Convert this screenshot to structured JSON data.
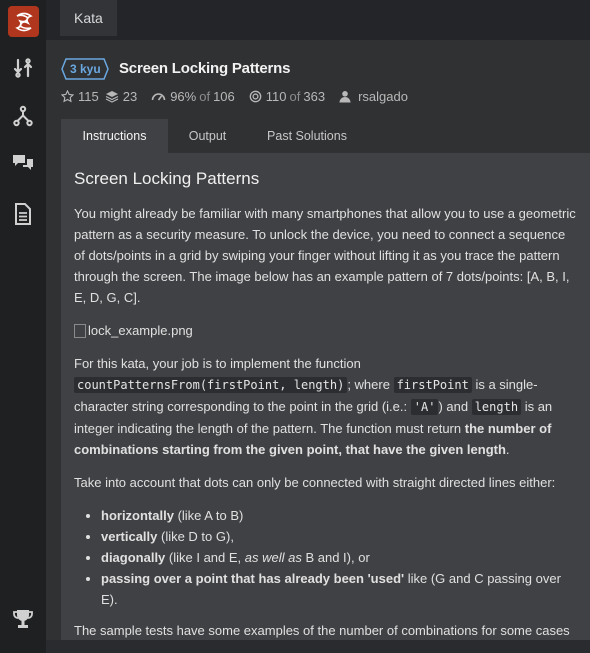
{
  "sidebar": {
    "logo_icon": "codewars-logo-icon",
    "items": [
      {
        "icon": "kata-arrows-icon"
      },
      {
        "icon": "fork-icon"
      },
      {
        "icon": "chat-bubbles-icon"
      },
      {
        "icon": "document-icon"
      }
    ],
    "bottom_icon": "trophy-icon"
  },
  "breadcrumb": {
    "label": "Kata"
  },
  "kata": {
    "rank": "3 kyu",
    "title": "Screen Locking Patterns",
    "stars": "115",
    "collections": "23",
    "satisfaction": "96%",
    "satisfaction_of": "of",
    "satisfaction_total": "106",
    "completed": "110",
    "completed_of": "of",
    "completed_total": "363",
    "author": "rsalgado"
  },
  "tabs": [
    {
      "label": "Instructions",
      "active": true
    },
    {
      "label": "Output",
      "active": false
    },
    {
      "label": "Past Solutions",
      "active": false
    }
  ],
  "description": {
    "heading": "Screen Locking Patterns",
    "p1": "You might already be familiar with many smartphones that allow you to use a geometric pattern as a security measure. To unlock the device, you need to connect a sequence of dots/points in a grid by swiping your finger without lifting it as you trace the pattern through the screen. The image below has an example pattern of 7 dots/points: [A, B, I, E, D, G, C].",
    "image_alt": "lock_example.png",
    "p2_a": "For this kata, your job is to implement the function",
    "p2_code1": "countPatternsFrom(firstPoint, length)",
    "p2_b": "; where",
    "p2_code2": "firstPoint",
    "p2_c": "is a single-character string corresponding to the point in the grid (i.e.:",
    "p2_code3": "'A'",
    "p2_d": ") and",
    "p2_code4": "length",
    "p2_e": "is an integer indicating the length of the pattern. The function must return",
    "p2_bold": "the number of combinations starting from the given point, that have the given length",
    "p2_end": ".",
    "p3": "Take into account that dots can only be connected with straight directed lines either:",
    "list": [
      {
        "bold": "horizontally",
        "rest": " (like A to B)"
      },
      {
        "bold": "vertically",
        "rest": " (like D to G),"
      },
      {
        "bold": "diagonally",
        "rest_a": " (like I and E, ",
        "italic": "as well as",
        "rest_b": " B and I), or"
      },
      {
        "bold": "passing over a point that has already been 'used'",
        "rest": " like (G and C passing over E)."
      }
    ],
    "p4": "The sample tests have some examples of the number of combinations for some cases to help you check your code."
  },
  "colors": {
    "accent": "#b1361e",
    "rank": "#6aa8e0",
    "background": "#303133",
    "panel": "#404144"
  }
}
